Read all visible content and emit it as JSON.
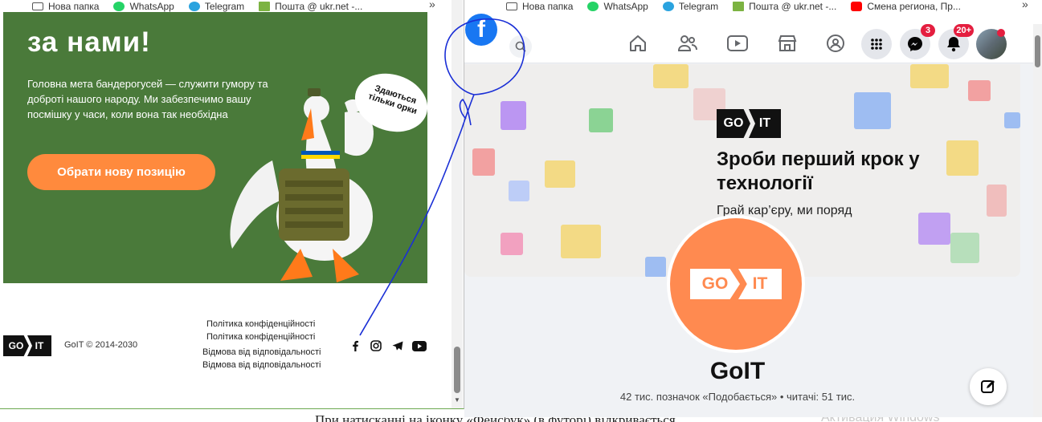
{
  "left_window": {
    "bookmarks": [
      {
        "label": "Нова папка",
        "icon": "folder-icon"
      },
      {
        "label": "WhatsApp",
        "icon": "whatsapp-icon"
      },
      {
        "label": "Telegram",
        "icon": "telegram-icon"
      },
      {
        "label": "Пошта @ ukr.net -...",
        "icon": "ukrnet-icon"
      }
    ],
    "more_bookmarks": "»",
    "hero": {
      "title": "за нами!",
      "text": "Головна мета бандерогусей — служити гумору та доброті нашого народу. Ми забезпечимо вашу посмішку у часи, коли вона так необхідна",
      "button": "Обрати нову позицію",
      "bubble": "Здаються тільки орки"
    },
    "footer": {
      "logo_go": "GO",
      "logo_it": "IT",
      "copyright": "GoIT © 2014-2030",
      "policy_1": "Політика конфіденційності",
      "policy_2": "Політика конфіденційності",
      "disclaimer_1": "Відмова від відповідальності",
      "disclaimer_2": "Відмова від відповідальності"
    }
  },
  "right_window": {
    "bookmarks": [
      {
        "label": "Нова папка",
        "icon": "folder-icon"
      },
      {
        "label": "WhatsApp",
        "icon": "whatsapp-icon"
      },
      {
        "label": "Telegram",
        "icon": "telegram-icon"
      },
      {
        "label": "Пошта @ ukr.net -...",
        "icon": "ukrnet-icon"
      },
      {
        "label": "Смена региона, Пр...",
        "icon": "youtube-icon"
      }
    ],
    "more_bookmarks": "»",
    "facebook": {
      "logo": "f",
      "messenger_badge": "3",
      "notifications_badge": "20+",
      "cover": {
        "logo_go": "GO",
        "logo_it": "IT",
        "title": "Зроби перший крок у технології",
        "subtitle": "Грай кар’єру, ми поряд"
      },
      "profile_logo_go": "GO",
      "profile_logo_it": "IT",
      "page_name": "GoIT",
      "stats": "42 тис. позначок «Подобається» • читачі: 51 тис."
    }
  },
  "document": {
    "text": "При натисканні на іконку «Фейсбук» (в футорі) відкривається",
    "watermark": "Активация Windows"
  },
  "colors": {
    "hero_green": "#4a7a3a",
    "orange": "#ff8a3d",
    "facebook_blue": "#1877f2",
    "badge_red": "#e41e3f"
  }
}
